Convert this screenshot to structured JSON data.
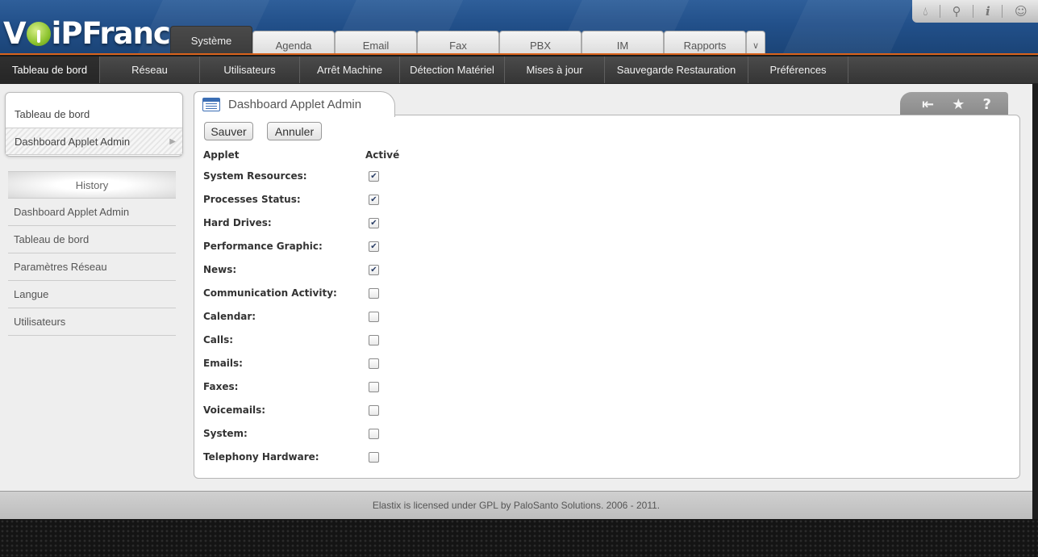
{
  "brand": {
    "logo_text_left": "V",
    "logo_text_right": "iPFrance"
  },
  "top_tools": [
    "drop-icon",
    "search-icon",
    "info-icon",
    "user-icon"
  ],
  "module_tabs": [
    {
      "label": "Système",
      "active": true
    },
    {
      "label": "Agenda"
    },
    {
      "label": "Email"
    },
    {
      "label": "Fax"
    },
    {
      "label": "PBX"
    },
    {
      "label": "IM"
    },
    {
      "label": "Rapports"
    }
  ],
  "subnav": [
    {
      "label": "Tableau de bord",
      "active": true
    },
    {
      "label": "Réseau"
    },
    {
      "label": "Utilisateurs"
    },
    {
      "label": "Arrêt Machine"
    },
    {
      "label": "Détection Matériel"
    },
    {
      "label": "Mises à jour"
    },
    {
      "label": "Sauvegarde Restauration"
    },
    {
      "label": "Préférences"
    }
  ],
  "left_menu": [
    {
      "label": "Tableau de bord"
    },
    {
      "label": "Dashboard Applet Admin",
      "selected": true
    }
  ],
  "history": {
    "title": "History",
    "items": [
      "Dashboard Applet Admin",
      "Tableau de bord",
      "Paramètres Réseau",
      "Langue",
      "Utilisateurs"
    ]
  },
  "panel": {
    "title": "Dashboard Applet Admin",
    "save_label": "Sauver",
    "cancel_label": "Annuler",
    "col_applet": "Applet",
    "col_active": "Activé",
    "applets": [
      {
        "name": "System Resources:",
        "checked": true
      },
      {
        "name": "Processes Status:",
        "checked": true
      },
      {
        "name": "Hard Drives:",
        "checked": true
      },
      {
        "name": "Performance Graphic:",
        "checked": true
      },
      {
        "name": "News:",
        "checked": true
      },
      {
        "name": "Communication Activity:",
        "checked": false
      },
      {
        "name": "Calendar:",
        "checked": false
      },
      {
        "name": "Calls:",
        "checked": false
      },
      {
        "name": "Emails:",
        "checked": false
      },
      {
        "name": "Faxes:",
        "checked": false
      },
      {
        "name": "Voicemails:",
        "checked": false
      },
      {
        "name": "System:",
        "checked": false
      },
      {
        "name": "Telephony Hardware:",
        "checked": false
      }
    ]
  },
  "footer": "Elastix is licensed under GPL by PaloSanto Solutions. 2006 - 2011.",
  "colors": {
    "accent": "#d9631c",
    "header_blue": "#22508a",
    "subnav_dark": "#3f3f3f"
  }
}
